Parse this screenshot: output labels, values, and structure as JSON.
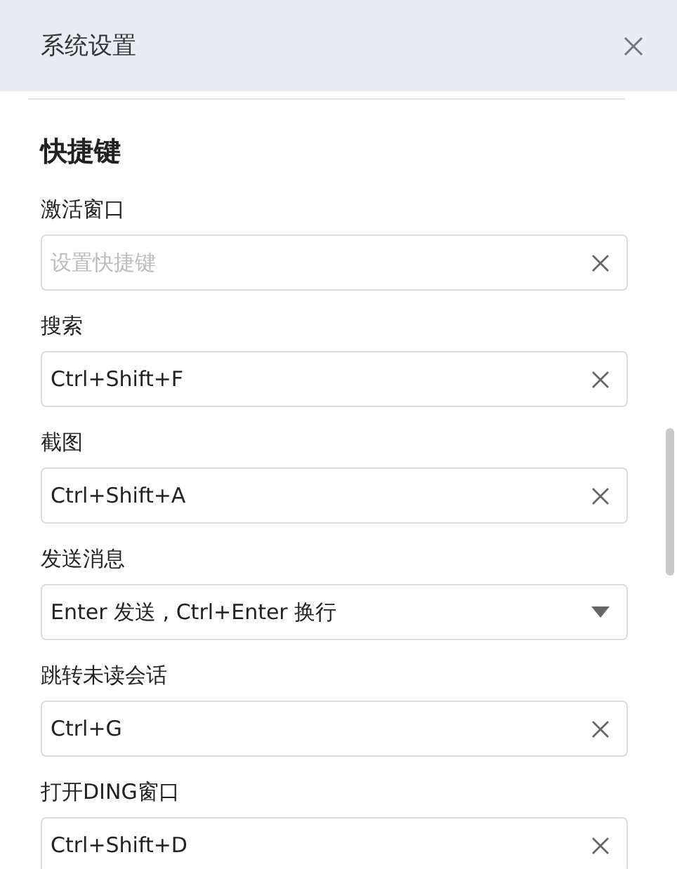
{
  "window": {
    "title": "系统设置"
  },
  "section": {
    "heading": "快捷键"
  },
  "fields": [
    {
      "label": "激活窗口",
      "kind": "shortcut",
      "placeholder": "设置快捷键"
    },
    {
      "label": "搜索",
      "kind": "shortcut",
      "value": "Ctrl+Shift+F"
    },
    {
      "label": "截图",
      "kind": "shortcut",
      "value": "Ctrl+Shift+A"
    },
    {
      "label": "发送消息",
      "kind": "select",
      "value": "Enter 发送 , Ctrl+Enter 换行"
    },
    {
      "label": "跳转未读会话",
      "kind": "shortcut",
      "value": "Ctrl+G"
    },
    {
      "label": "打开DING窗口",
      "kind": "shortcut",
      "value": "Ctrl+Shift+D"
    }
  ]
}
